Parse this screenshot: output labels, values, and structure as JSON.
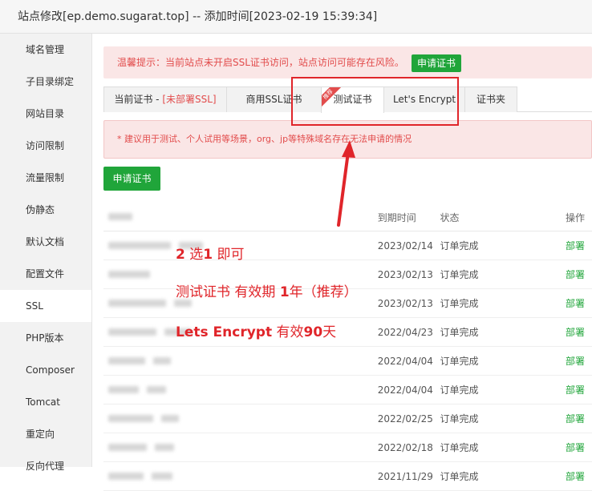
{
  "window": {
    "title": "站点修改[ep.demo.sugarat.top] -- 添加时间[2023-02-19 15:39:34]"
  },
  "sidebar": {
    "items": [
      {
        "label": "域名管理"
      },
      {
        "label": "子目录绑定"
      },
      {
        "label": "网站目录"
      },
      {
        "label": "访问限制"
      },
      {
        "label": "流量限制"
      },
      {
        "label": "伪静态"
      },
      {
        "label": "默认文档"
      },
      {
        "label": "配置文件"
      },
      {
        "label": "SSL"
      },
      {
        "label": "PHP版本"
      },
      {
        "label": "Composer"
      },
      {
        "label": "Tomcat"
      },
      {
        "label": "重定向"
      },
      {
        "label": "反向代理"
      }
    ],
    "active": "SSL"
  },
  "warning": {
    "text": "温馨提示：当前站点未开启SSL证书访问，站点访问可能存在风险。",
    "button": "申请证书"
  },
  "tabs": {
    "current_prefix": "当前证书 - ",
    "current_status": "[未部署SSL]",
    "commercial": "商用SSL证书",
    "commercial_badge": "推荐",
    "test": "测试证书",
    "letsencrypt": "Let's Encrypt",
    "folder": "证书夹"
  },
  "note": {
    "text": "* 建议用于测试、个人试用等场景，org、jp等特殊域名存在无法申请的情况"
  },
  "apply_button": "申请证书",
  "table": {
    "headers": {
      "expire": "到期时间",
      "status": "状态",
      "action": "操作"
    },
    "rows": [
      {
        "expire": "2023/02/14",
        "status": "订单完成",
        "action": "部署"
      },
      {
        "expire": "2023/02/13",
        "status": "订单完成",
        "action": "部署"
      },
      {
        "expire": "2023/02/13",
        "status": "订单完成",
        "action": "部署"
      },
      {
        "expire": "2022/04/23",
        "status": "订单完成",
        "action": "部署"
      },
      {
        "expire": "2022/04/04",
        "status": "订单完成",
        "action": "部署"
      },
      {
        "expire": "2022/04/04",
        "status": "订单完成",
        "action": "部署"
      },
      {
        "expire": "2022/02/25",
        "status": "订单完成",
        "action": "部署"
      },
      {
        "expire": "2022/02/18",
        "status": "订单完成",
        "action": "部署"
      },
      {
        "expire": "2021/11/29",
        "status": "订单完成",
        "action": "部署"
      }
    ]
  },
  "annotations": {
    "line1_num1": "2",
    "line1_mid": " 选",
    "line1_num2": "1",
    "line1_tail": " 即可",
    "line2_a": "测试证书 有效期 ",
    "line2_num": "1",
    "line2_b": "年（推荐）",
    "line3_a": "Lets Encrypt",
    "line3_b": "  有效",
    "line3_num": "90",
    "line3_c": "天"
  },
  "colors": {
    "accent_green": "#20a53a",
    "warning_red": "#e24c4c",
    "annotation_red": "#e0252a"
  }
}
